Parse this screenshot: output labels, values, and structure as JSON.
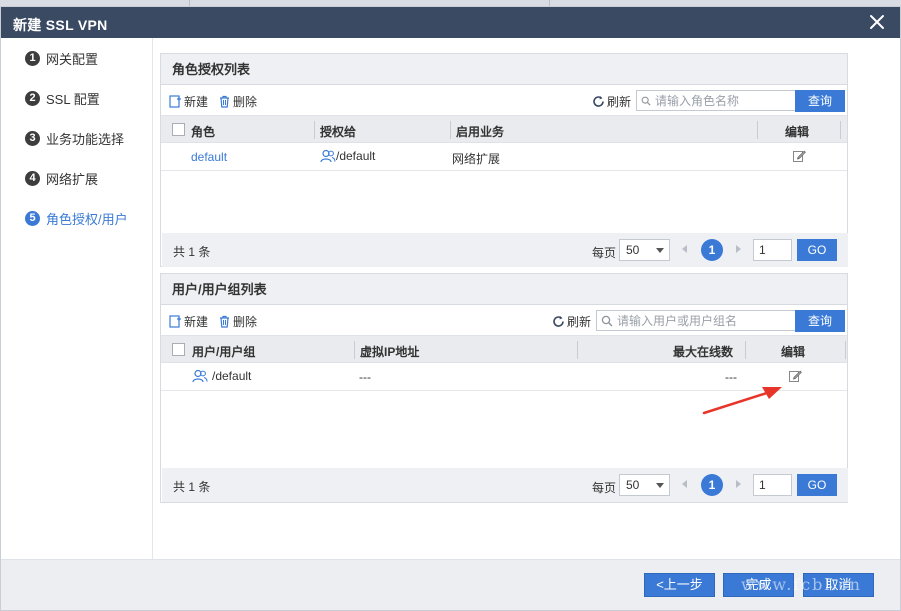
{
  "dialog": {
    "title": "新建 SSL VPN"
  },
  "steps": [
    {
      "num": "1",
      "label": "网关配置"
    },
    {
      "num": "2",
      "label": "SSL 配置"
    },
    {
      "num": "3",
      "label": "业务功能选择"
    },
    {
      "num": "4",
      "label": "网络扩展"
    },
    {
      "num": "5",
      "label": "角色授权/用户",
      "active": true
    }
  ],
  "role_panel": {
    "title": "角色授权列表",
    "new_label": "新建",
    "delete_label": "删除",
    "refresh_label": "刷新",
    "search_placeholder": "请输入角色名称",
    "query_label": "查询",
    "columns": [
      "角色",
      "授权给",
      "启用业务",
      "编辑"
    ],
    "rows": [
      {
        "role": "default",
        "granted_to": "/default",
        "services": "网络扩展"
      }
    ],
    "pager": {
      "total": "共 1 条",
      "per_page_label": "每页",
      "per_page": "50",
      "current_page": "1",
      "page_input": "1",
      "go_label": "GO"
    }
  },
  "user_panel": {
    "title": "用户/用户组列表",
    "new_label": "新建",
    "delete_label": "删除",
    "refresh_label": "刷新",
    "search_placeholder": "请输入用户或用户组名",
    "query_label": "查询",
    "columns": [
      "用户/用户组",
      "虚拟IP地址",
      "最大在线数",
      "编辑"
    ],
    "rows": [
      {
        "user": "/default",
        "virtual_ip": "---",
        "max_online": "---"
      }
    ],
    "pager": {
      "total": "共 1 条",
      "per_page_label": "每页",
      "per_page": "50",
      "current_page": "1",
      "page_input": "1",
      "go_label": "GO"
    }
  },
  "footer": {
    "prev_label": "<上一步",
    "finish_label": "完成",
    "cancel_label": "取消"
  },
  "watermark": "www.fcbl.cn",
  "colors": {
    "titlebar": "#3a4a63",
    "accent": "#3a7ad6",
    "annotation_arrow": "#e8352a"
  }
}
